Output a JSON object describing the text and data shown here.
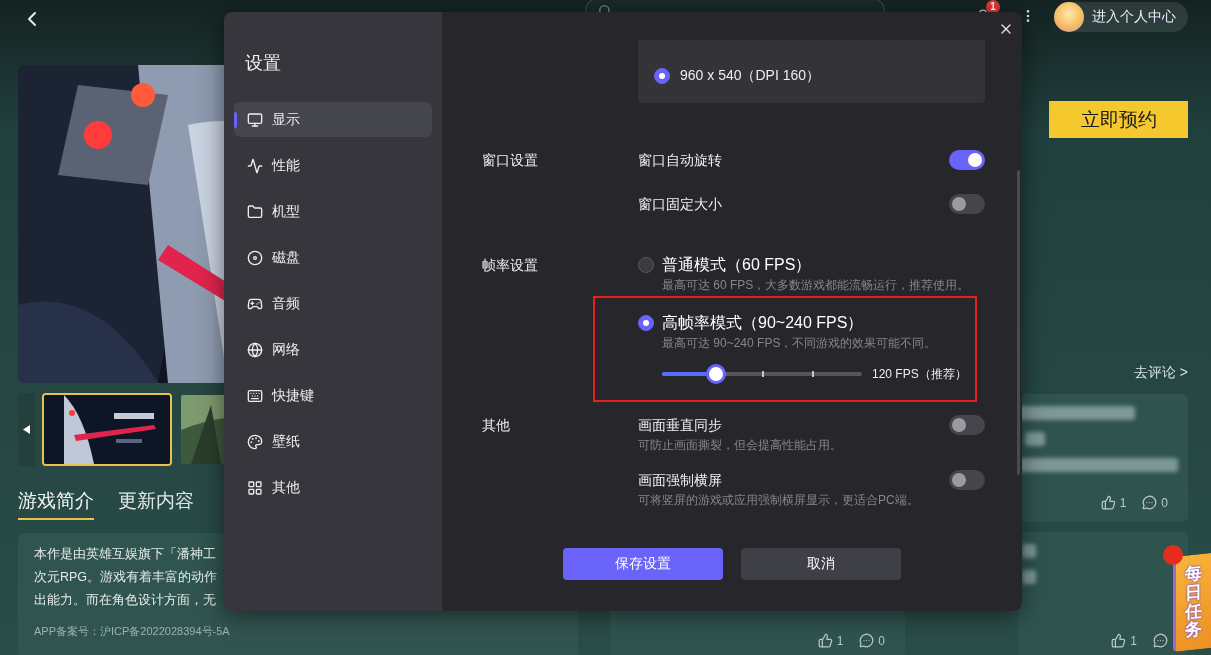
{
  "top_bar": {
    "notification_badge": "1",
    "profile_button": "进入个人中心"
  },
  "game": {
    "reserve_button": "立即预约",
    "thumbnails": [
      {
        "selected": true
      },
      {
        "selected": false
      }
    ],
    "tabs": [
      {
        "label": "游戏简介",
        "selected": true
      },
      {
        "label": "更新内容",
        "selected": false
      }
    ],
    "description_lines": [
      "本作是由英雄互娱旗下「潘神工",
      "次元RPG。游戏有着丰富的动作",
      "出能力。而在角色设计方面，无"
    ],
    "record_number": "APP备案号：沪ICP备2022028394号-5A"
  },
  "comments": {
    "link": "去评论 >",
    "side": [
      {
        "likes": "1",
        "replies": "0"
      },
      {
        "likes": "1"
      }
    ],
    "main": [
      {
        "likes": "1",
        "replies": "0"
      }
    ]
  },
  "daily_task": {
    "label": "每日任务"
  },
  "settings": {
    "title": "设置",
    "nav": [
      {
        "label": "显示",
        "selected": true
      },
      {
        "label": "性能",
        "selected": false
      },
      {
        "label": "机型",
        "selected": false
      },
      {
        "label": "磁盘",
        "selected": false
      },
      {
        "label": "音频",
        "selected": false
      },
      {
        "label": "网络",
        "selected": false
      },
      {
        "label": "快捷键",
        "selected": false
      },
      {
        "label": "壁纸",
        "selected": false
      },
      {
        "label": "其他",
        "selected": false
      }
    ],
    "resolutions": [
      {
        "label": "960 x 540（DPI 160）",
        "selected": true
      }
    ],
    "sections": [
      {
        "label": "窗口设置",
        "items": [
          {
            "kind": "toggle",
            "label": "窗口自动旋转",
            "on": true
          },
          {
            "kind": "toggle",
            "label": "窗口固定大小",
            "on": false
          }
        ]
      },
      {
        "label": "帧率设置",
        "items": [
          {
            "kind": "radio",
            "label": "普通模式（60 FPS）",
            "description": "最高可达 60 FPS，大多数游戏都能流畅运行，推荐使用。",
            "selected": false,
            "highlighted": false
          },
          {
            "kind": "radio",
            "label": "高帧率模式（90~240 FPS）",
            "description": "最高可达 90~240 FPS，不同游戏的效果可能不同。",
            "selected": true,
            "highlighted": true,
            "slider": {
              "level": 0.27,
              "reading": "120 FPS（推荐）"
            }
          }
        ]
      },
      {
        "label": "其他",
        "items": [
          {
            "kind": "toggle",
            "label": "画面垂直同步",
            "description": "可防止画面撕裂，但会提高性能占用。",
            "on": false
          },
          {
            "kind": "toggle",
            "label": "画面强制横屏",
            "description": "可将竖屏的游戏或应用强制横屏显示，更适合PC端。",
            "on": false
          }
        ]
      }
    ],
    "buttons": [
      {
        "label": "保存设置",
        "kind": "primary"
      },
      {
        "label": "取消",
        "kind": "secondary"
      }
    ]
  }
}
